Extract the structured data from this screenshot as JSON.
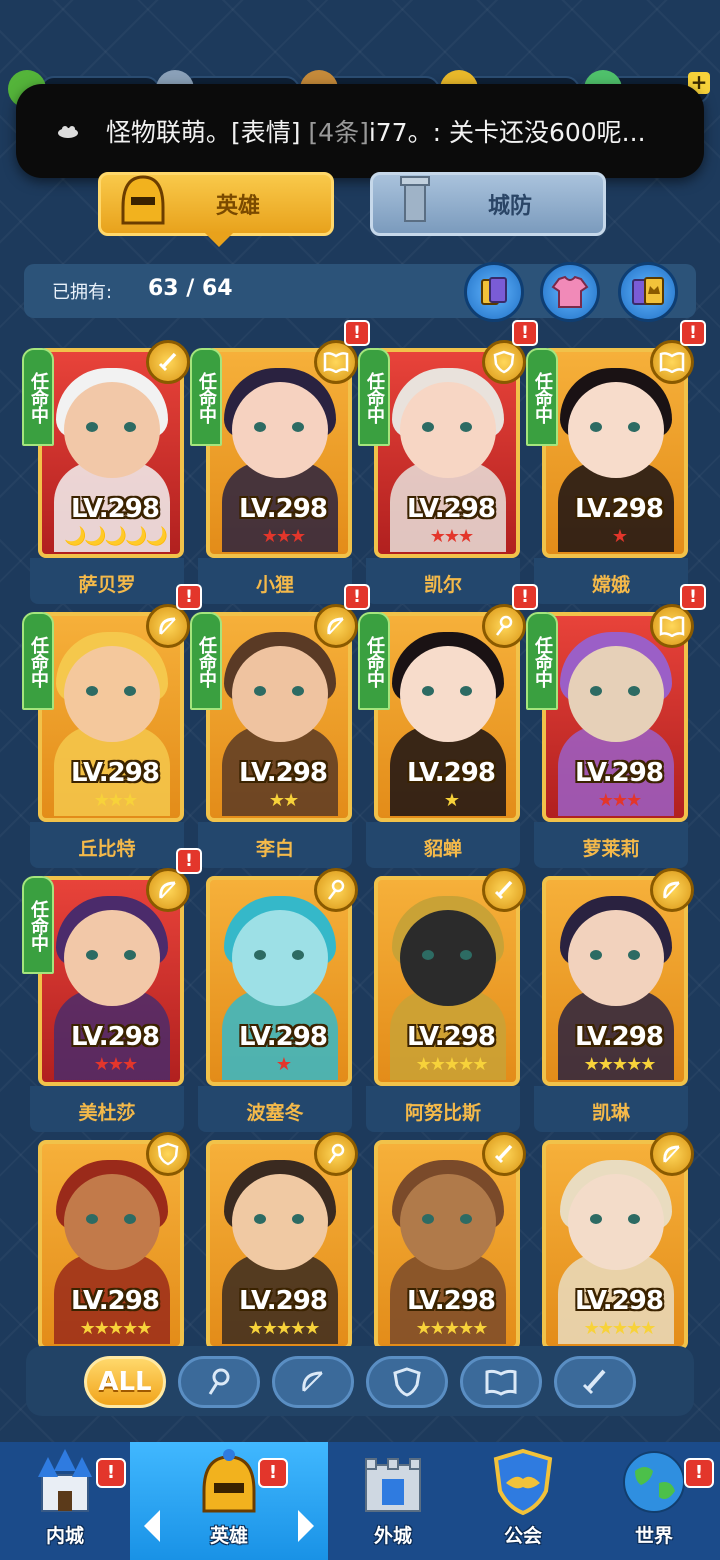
{
  "notification": {
    "sender": "怪物联萌。",
    "emoji_tag": "[表情]",
    "count": "[4条]",
    "message": "i77。: 关卡还没600呢..."
  },
  "tabs": [
    {
      "label": "英雄",
      "active": true
    },
    {
      "label": "城防",
      "active": false
    }
  ],
  "owned": {
    "label": "已拥有:",
    "count": "63 / 64"
  },
  "appoint_label": "任命中",
  "heroes": [
    {
      "name": "萨贝罗",
      "level": "LV.298",
      "stars": "🌙🌙🌙🌙🌙",
      "star_color": "#e3362b",
      "appointed": true,
      "alert": false,
      "badge": "sword-icon",
      "bg": "red"
    },
    {
      "name": "小狸",
      "level": "LV.298",
      "stars": "★★★",
      "star_color": "#e3362b",
      "appointed": true,
      "alert": true,
      "badge": "book-icon",
      "bg": "gold"
    },
    {
      "name": "凯尔",
      "level": "LV.298",
      "stars": "★★★",
      "star_color": "#e3362b",
      "appointed": true,
      "alert": true,
      "badge": "shield-icon",
      "bg": "red"
    },
    {
      "name": "嫦娥",
      "level": "LV.298",
      "stars": "★",
      "star_color": "#e3362b",
      "appointed": true,
      "alert": true,
      "badge": "book-icon",
      "bg": "gold"
    },
    {
      "name": "丘比特",
      "level": "LV.298",
      "stars": "★★★",
      "star_color": "#f7d23a",
      "appointed": true,
      "alert": true,
      "badge": "bow-icon",
      "bg": "gold"
    },
    {
      "name": "李白",
      "level": "LV.298",
      "stars": "★★",
      "star_color": "#f7d23a",
      "appointed": true,
      "alert": true,
      "badge": "bow-icon",
      "bg": "gold"
    },
    {
      "name": "貂蝉",
      "level": "LV.298",
      "stars": "★",
      "star_color": "#f7d23a",
      "appointed": true,
      "alert": true,
      "badge": "staff-icon",
      "bg": "gold"
    },
    {
      "name": "萝莱莉",
      "level": "LV.298",
      "stars": "★★★",
      "star_color": "#e3362b",
      "appointed": true,
      "alert": true,
      "badge": "book-icon",
      "bg": "red"
    },
    {
      "name": "美杜莎",
      "level": "LV.298",
      "stars": "★★★",
      "star_color": "#e3362b",
      "appointed": true,
      "alert": true,
      "badge": "bow-icon",
      "bg": "red"
    },
    {
      "name": "波塞冬",
      "level": "LV.298",
      "stars": "★",
      "star_color": "#e3362b",
      "appointed": false,
      "alert": false,
      "badge": "staff-icon",
      "bg": "gold"
    },
    {
      "name": "阿努比斯",
      "level": "LV.298",
      "stars": "★★★★★",
      "star_color": "#f7d23a",
      "appointed": false,
      "alert": false,
      "badge": "sword-icon",
      "bg": "gold"
    },
    {
      "name": "凯琳",
      "level": "LV.298",
      "stars": "★★★★★",
      "star_color": "#f7d23a",
      "appointed": false,
      "alert": false,
      "badge": "bow-icon",
      "bg": "gold"
    },
    {
      "name": "",
      "level": "LV.298",
      "stars": "★★★★★",
      "star_color": "#f7d23a",
      "appointed": false,
      "alert": false,
      "badge": "shield-icon",
      "bg": "gold"
    },
    {
      "name": "",
      "level": "LV.298",
      "stars": "★★★★★",
      "star_color": "#f7d23a",
      "appointed": false,
      "alert": false,
      "badge": "staff-icon",
      "bg": "gold"
    },
    {
      "name": "",
      "level": "LV.298",
      "stars": "★★★★★",
      "star_color": "#f7d23a",
      "appointed": false,
      "alert": false,
      "badge": "sword-icon",
      "bg": "gold"
    },
    {
      "name": "",
      "level": "LV.298",
      "stars": "★★★★★",
      "star_color": "#f7d23a",
      "appointed": false,
      "alert": false,
      "badge": "bow-icon",
      "bg": "gold"
    }
  ],
  "filters": [
    {
      "label": "ALL",
      "icon": "all"
    },
    {
      "label": "",
      "icon": "staff-icon"
    },
    {
      "label": "",
      "icon": "bow-icon"
    },
    {
      "label": "",
      "icon": "shield-icon"
    },
    {
      "label": "",
      "icon": "book-icon"
    },
    {
      "label": "",
      "icon": "sword-icon"
    }
  ],
  "nav": [
    {
      "label": "内城",
      "alert": true
    },
    {
      "label": "英雄",
      "alert": true,
      "active": true
    },
    {
      "label": "外城",
      "alert": false
    },
    {
      "label": "公会",
      "alert": false
    },
    {
      "label": "世界",
      "alert": true
    }
  ],
  "alert_mark": "!",
  "colors": {
    "accent_gold": "#f1c24a",
    "name_gold": "#f4b94a",
    "appoint_green": "#3aa040",
    "alert_red": "#e3362b"
  }
}
